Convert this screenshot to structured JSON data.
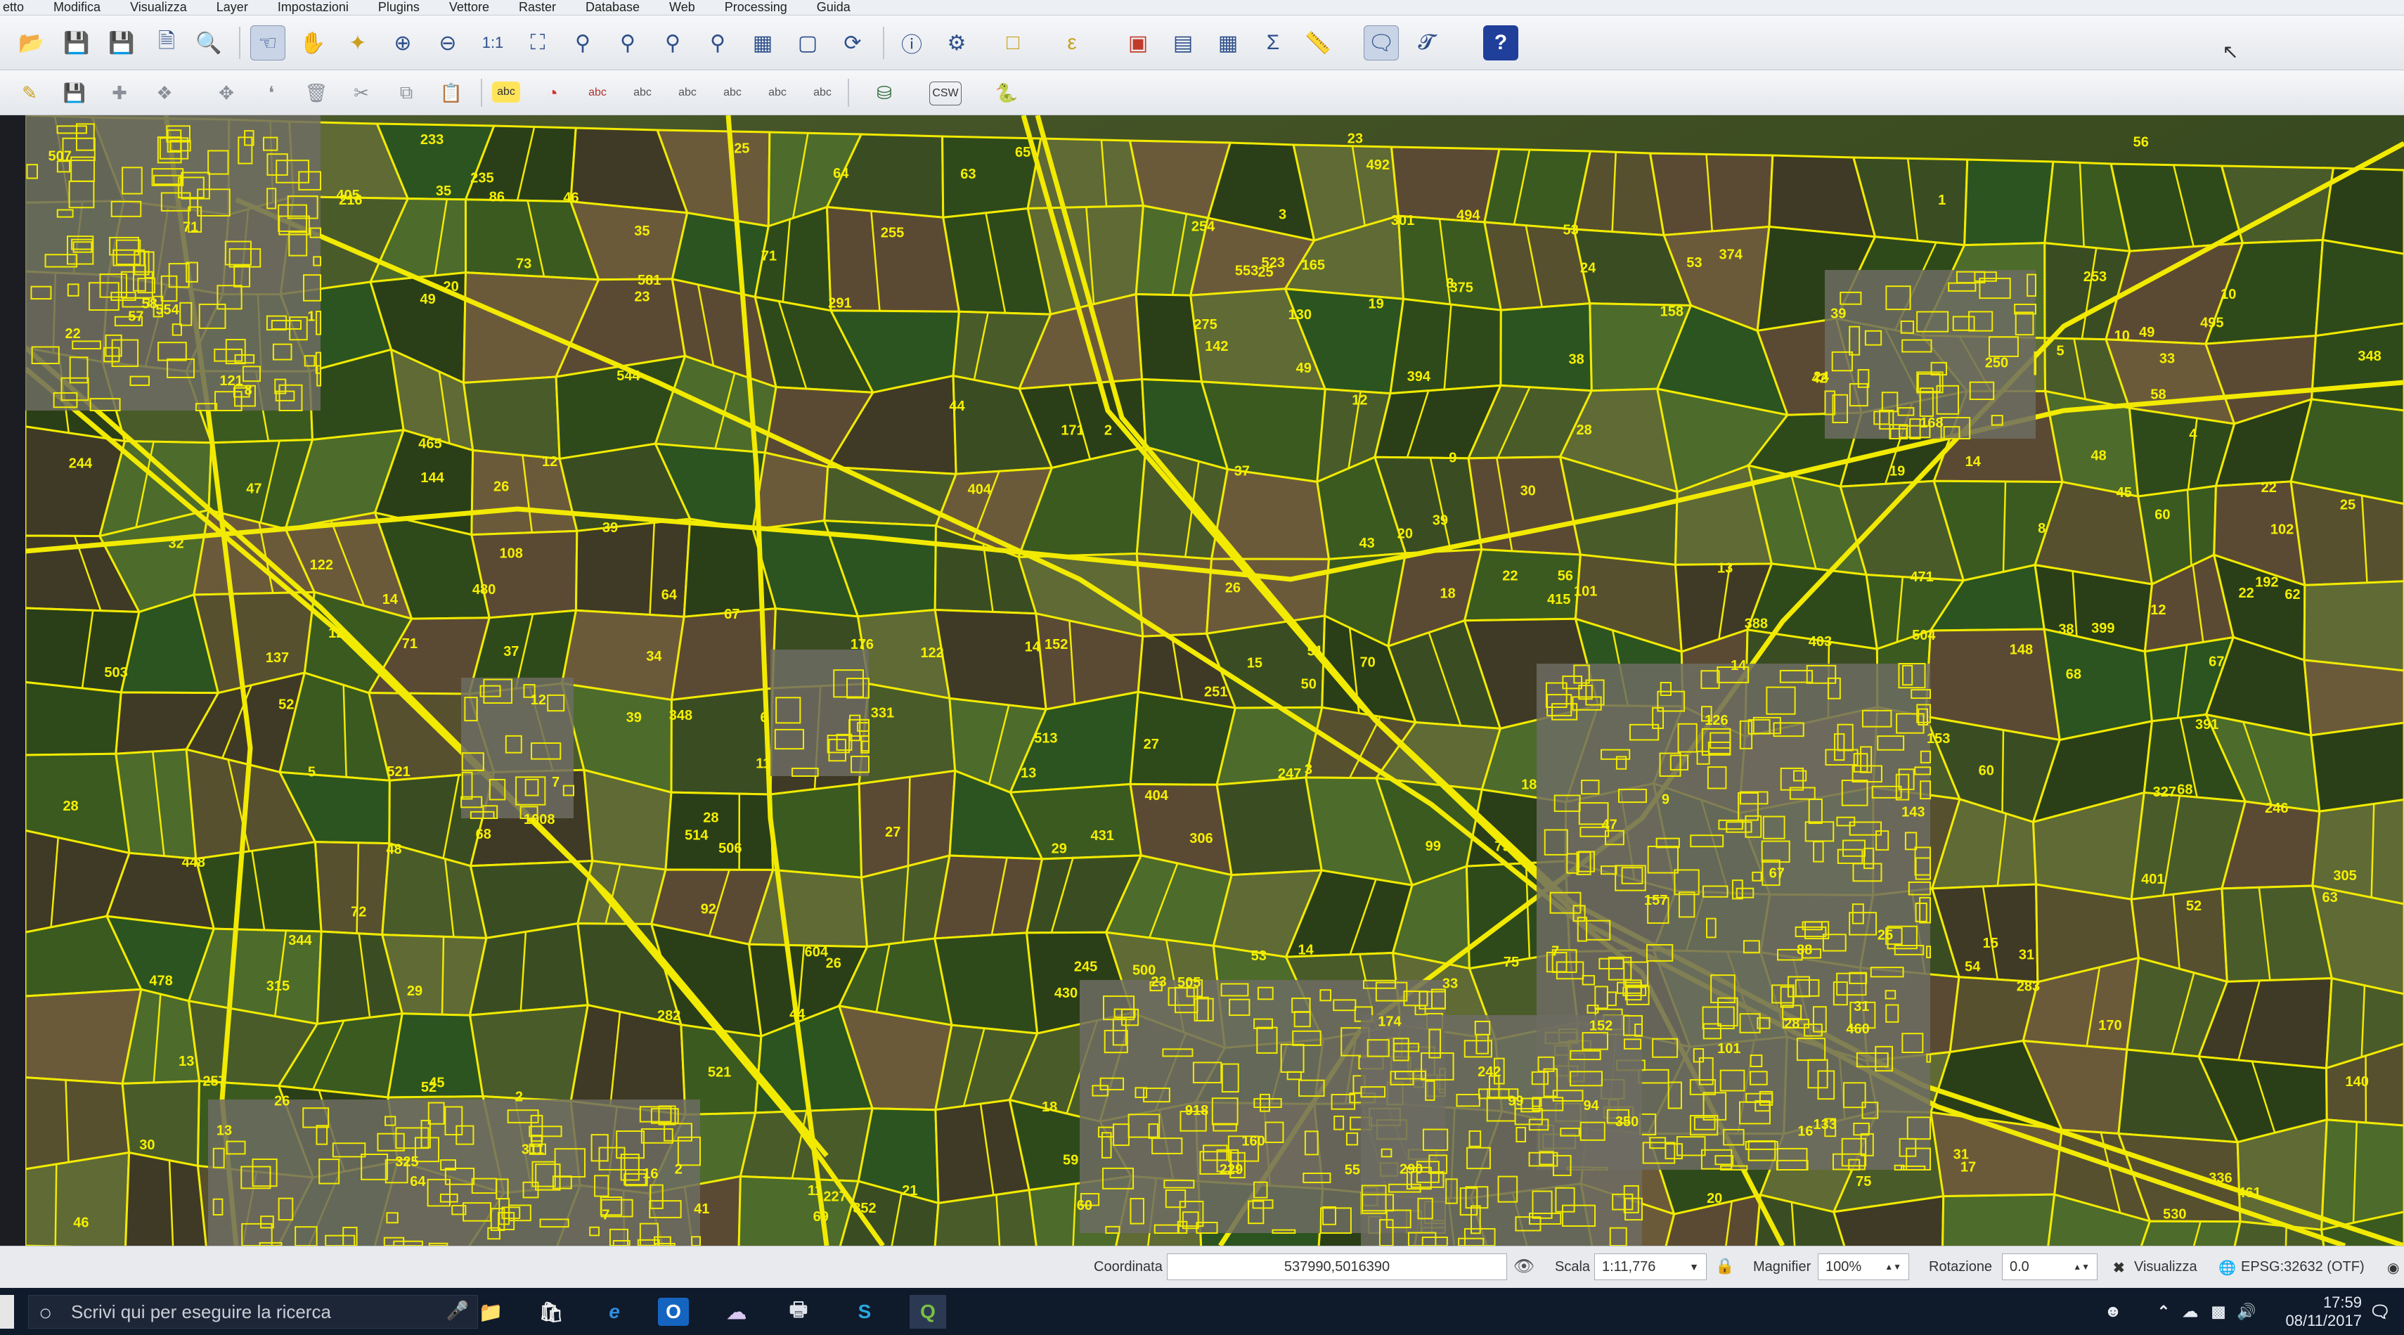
{
  "menu": {
    "items": [
      "etto",
      "Modifica",
      "Visualizza",
      "Layer",
      "Impostazioni",
      "Plugins",
      "Vettore",
      "Raster",
      "Database",
      "Web",
      "Processing",
      "Guida"
    ]
  },
  "toolbar": {
    "csw_label": "CSW",
    "abc_label": "abc"
  },
  "map": {
    "theme": {
      "parcel_outline": "#f2ea00",
      "label_color": "#f6f000"
    },
    "parcel_labels": [
      "507",
      "471",
      "67",
      "38",
      "39",
      "62",
      "64",
      "67",
      "245",
      "246",
      "69",
      "71",
      "39",
      "344",
      "480",
      "12",
      "63",
      "68",
      "99",
      "1",
      "2",
      "3",
      "142",
      "247",
      "348",
      "48",
      "49",
      "70",
      "45",
      "46",
      "55",
      "5",
      "350",
      "352",
      "14",
      "492",
      "152",
      "60",
      "64",
      "44",
      "192",
      "19",
      "22",
      "170",
      "461",
      "47",
      "28",
      "53",
      "19",
      "24",
      "26",
      "29",
      "7",
      "171",
      "60",
      "301",
      "49",
      "8",
      "1",
      "16",
      "22",
      "25",
      "28",
      "31",
      "12",
      "153",
      "399",
      "108",
      "404",
      "72",
      "13",
      "448",
      "176",
      "30",
      "102",
      "10",
      "23",
      "9",
      "51",
      "50",
      "130",
      "165",
      "168",
      "46",
      "143",
      "305",
      "405",
      "57",
      "32",
      "3",
      "33",
      "8",
      "37",
      "41",
      "42",
      "53",
      "59",
      "54",
      "68",
      "306",
      "12",
      "14",
      "514",
      "311",
      "7",
      "315",
      "12",
      "13",
      "2",
      "18",
      "20",
      "38",
      "22",
      "52",
      "88",
      "374",
      "283",
      "290",
      "291",
      "16",
      "348",
      "521",
      "325",
      "33",
      "65",
      "71",
      "23",
      "39",
      "43",
      "44",
      "235",
      "255",
      "30",
      "20",
      "503",
      "282",
      "99",
      "523",
      "327",
      "31",
      "73",
      "25",
      "49",
      "26",
      "251",
      "28",
      "504",
      "216",
      "101",
      "401",
      "391",
      "92",
      "394",
      "27",
      "28",
      "254",
      "250",
      "18",
      "233",
      "554",
      "553",
      "465",
      "404",
      "24",
      "506",
      "79",
      "58",
      "122",
      "7",
      "8",
      "229",
      "253",
      "331",
      "494",
      "60",
      "37",
      "75",
      "94",
      "64",
      "75",
      "137",
      "48",
      "257",
      "63",
      "513",
      "53",
      "10",
      "530",
      "121",
      "101",
      "52",
      "47",
      "22",
      "13",
      "14",
      "160",
      "1008",
      "45",
      "242",
      "20",
      "86",
      "544",
      "604",
      "460",
      "52",
      "4",
      "174",
      "148",
      "140",
      "56",
      "244",
      "34",
      "2",
      "6",
      "5",
      "430",
      "157",
      "158",
      "133",
      "122",
      "58",
      "35",
      "25",
      "27",
      "31",
      "71",
      "388",
      "227",
      "431",
      "56",
      "918",
      "12",
      "25",
      "26",
      "14",
      "23",
      "18",
      "26",
      "35",
      "29",
      "39",
      "336",
      "495",
      "500",
      "375",
      "275",
      "15",
      "68",
      "17",
      "9",
      "478",
      "581",
      "415",
      "152",
      "126",
      "21",
      "67",
      "505",
      "403",
      "144",
      "13",
      "14",
      "15",
      "11",
      "521",
      "11"
    ]
  },
  "statusbar": {
    "coord_label": "Coordinata",
    "coord_value": "537990,5016390",
    "scale_label": "Scala",
    "scale_value": "1:11,776",
    "magnifier_label": "Magnifier",
    "magnifier_value": "100%",
    "rotation_label": "Rotazione",
    "rotation_value": "0.0",
    "render_label": "Visualizza",
    "crs_label": "EPSG:32632 (OTF)"
  },
  "taskbar": {
    "search_placeholder": "Scrivi qui per eseguire la ricerca",
    "time": "17:59",
    "date": "08/11/2017"
  }
}
